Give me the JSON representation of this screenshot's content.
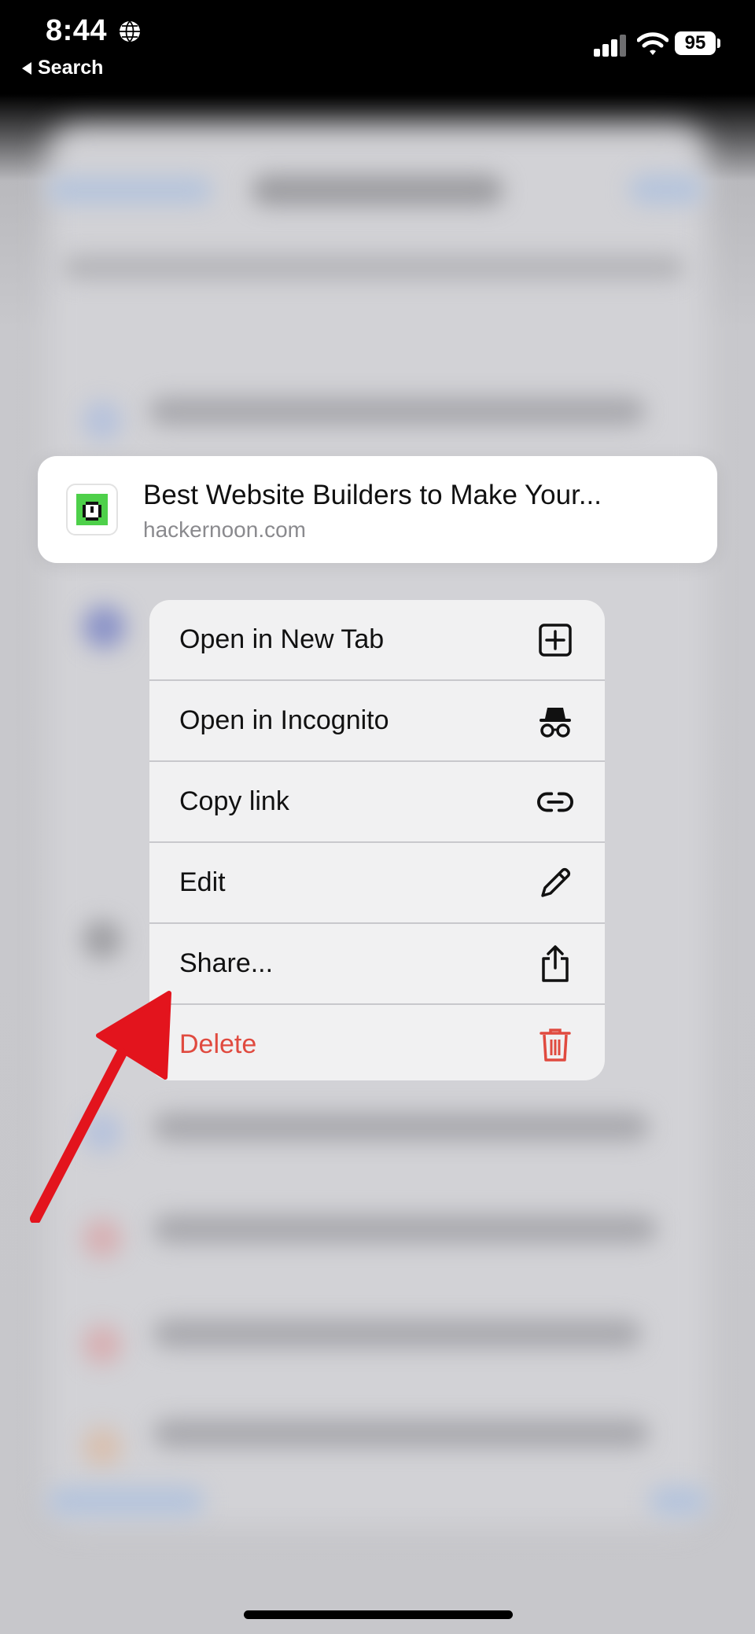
{
  "status_bar": {
    "time": "8:44",
    "back_label": "Search",
    "battery": "95"
  },
  "preview": {
    "title": "Best Website Builders to Make Your...",
    "url": "hackernoon.com",
    "favicon": "hackernoon-icon"
  },
  "menu": {
    "items": [
      {
        "label": "Open in New Tab",
        "icon": "plus-square-icon"
      },
      {
        "label": "Open in Incognito",
        "icon": "incognito-icon"
      },
      {
        "label": "Copy link",
        "icon": "link-icon"
      },
      {
        "label": "Edit",
        "icon": "pencil-icon"
      },
      {
        "label": "Share...",
        "icon": "share-icon"
      },
      {
        "label": "Delete",
        "icon": "trash-icon"
      }
    ]
  },
  "colors": {
    "danger": "#e04a3f",
    "annotation_arrow": "#e3141d",
    "favicon_green": "#4ed04a"
  }
}
